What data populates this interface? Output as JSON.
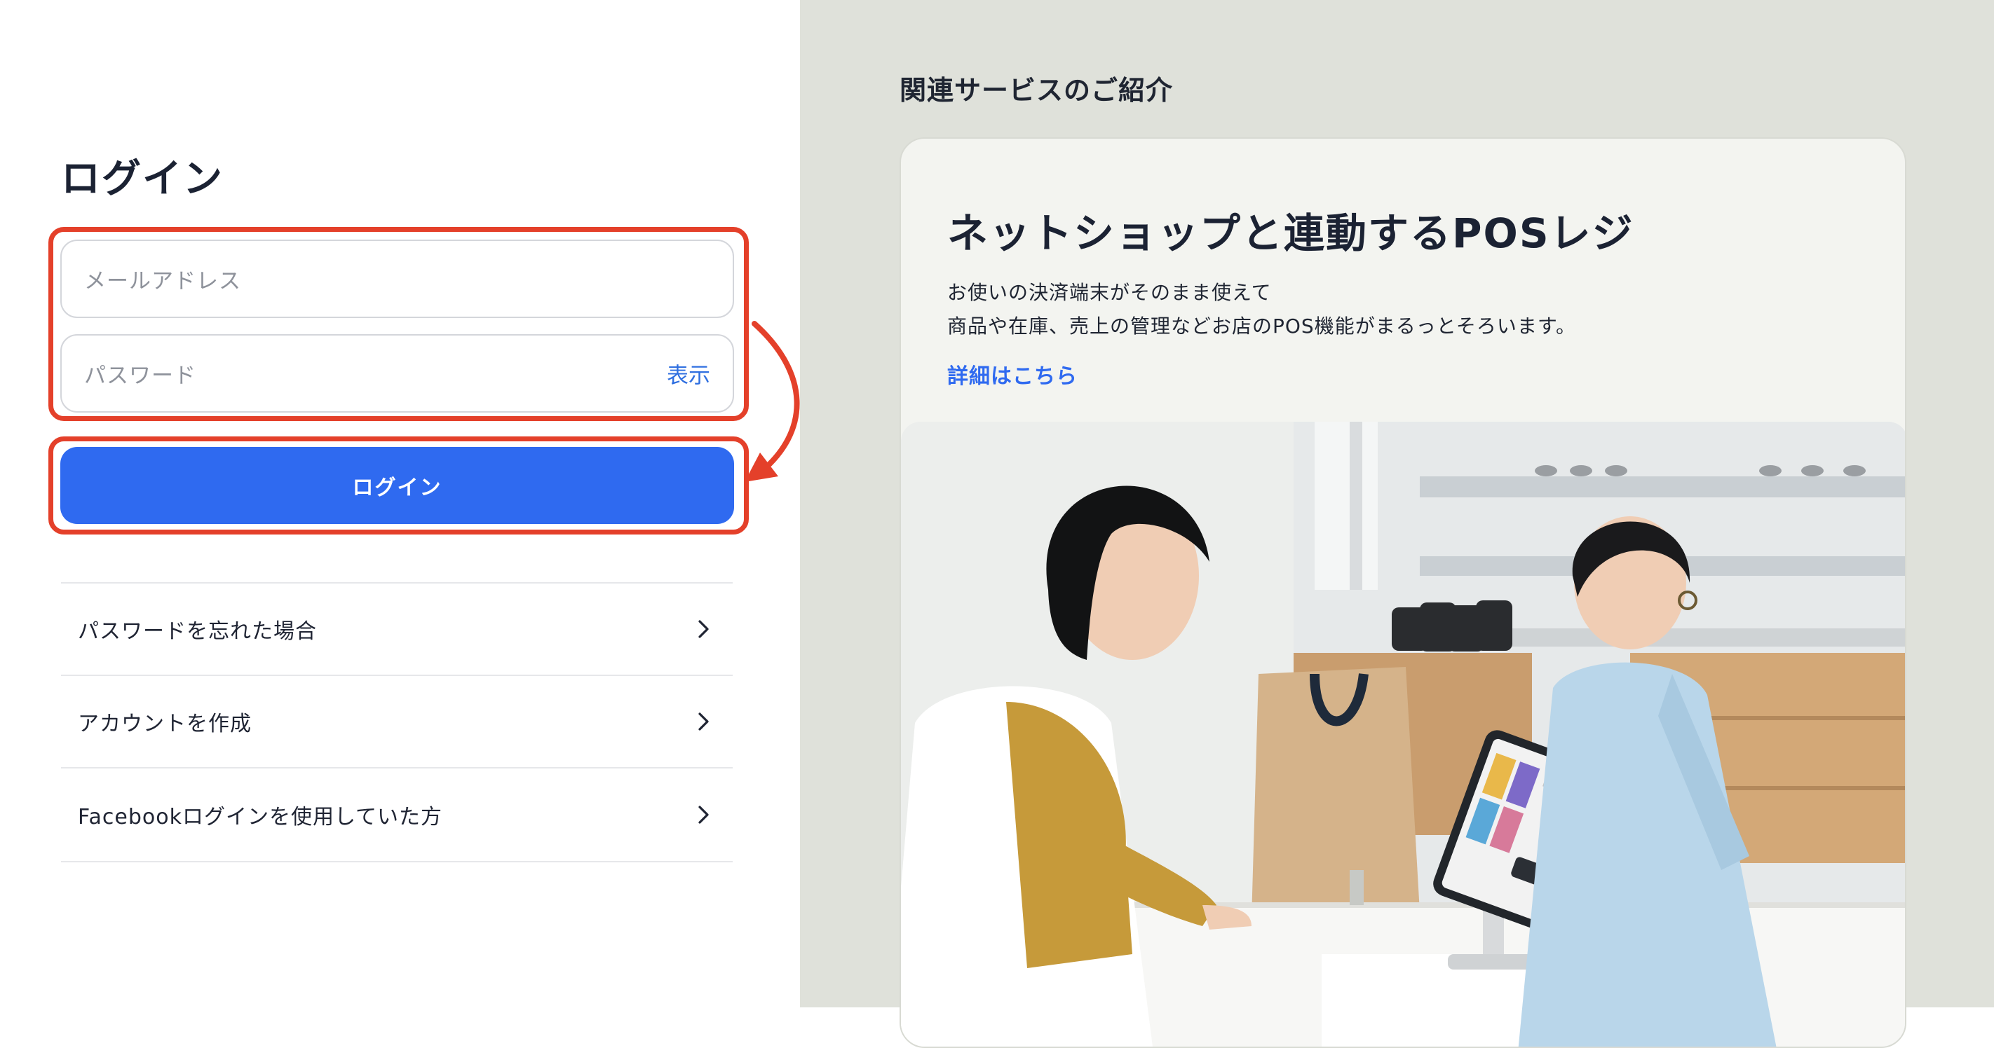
{
  "login": {
    "title": "ログイン",
    "email_placeholder": "メールアドレス",
    "password_placeholder": "パスワード",
    "show_password_label": "表示",
    "login_button_label": "ログイン",
    "links": [
      {
        "label": "パスワードを忘れた場合",
        "icon": "chevron-right-icon"
      },
      {
        "label": "アカウントを作成",
        "icon": "chevron-right-icon"
      },
      {
        "label": "Facebookログインを使用していた方",
        "icon": "chevron-right-icon"
      }
    ]
  },
  "promo": {
    "section_title": "関連サービスのご紹介",
    "card": {
      "heading": "ネットショップと連動するPOSレジ",
      "description_line1": "お使いの決済端末がそのまま使えて",
      "description_line2": "商品や在庫、売上の管理などお店のPOS機能がまるっとそろいます。",
      "link_label": "詳細はこちら"
    }
  },
  "colors": {
    "accent_blue": "#2f6af0",
    "annotation_red": "#e4402a",
    "right_panel_bg": "#dfe1da",
    "card_bg": "#f3f4f0"
  }
}
